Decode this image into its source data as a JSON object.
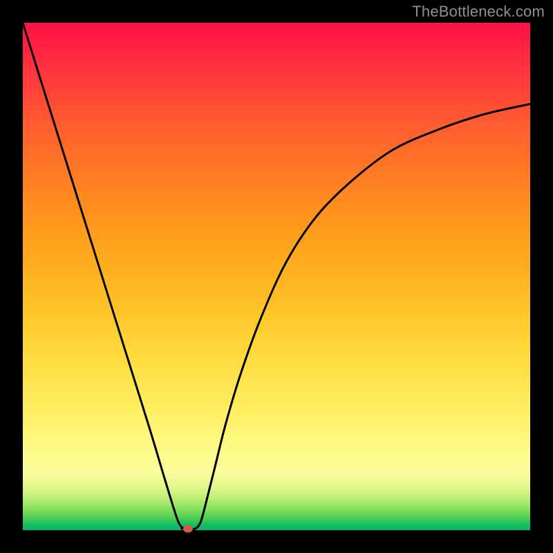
{
  "watermark": "TheBottleneck.com",
  "colors": {
    "frame": "#000000",
    "curve": "#000000",
    "dot": "#d45a4a",
    "gradient_top": "#ff1245",
    "gradient_bottom": "#00b96d"
  },
  "chart_data": {
    "type": "line",
    "title": "",
    "xlabel": "",
    "ylabel": "",
    "xlim": [
      0,
      100
    ],
    "ylim": [
      0,
      100
    ],
    "grid": false,
    "legend": false,
    "annotations": [],
    "series": [
      {
        "name": "bottleneck-curve",
        "x": [
          0,
          5,
          10,
          15,
          20,
          25,
          28,
          30,
          31,
          32,
          33,
          34,
          35,
          36,
          38,
          40,
          43,
          47,
          52,
          58,
          65,
          73,
          82,
          91,
          100
        ],
        "values": [
          100,
          84,
          68,
          52,
          36,
          20,
          10,
          3.5,
          1.0,
          0.3,
          0.3,
          0.3,
          1.5,
          5,
          13,
          21,
          31,
          42,
          53,
          62,
          69,
          75,
          79,
          82,
          84
        ]
      },
      {
        "name": "flat-bottom",
        "x": [
          31.3,
          33.3
        ],
        "values": [
          0.3,
          0.3
        ]
      }
    ],
    "marker": {
      "x": 32.5,
      "y": 0.3
    }
  }
}
